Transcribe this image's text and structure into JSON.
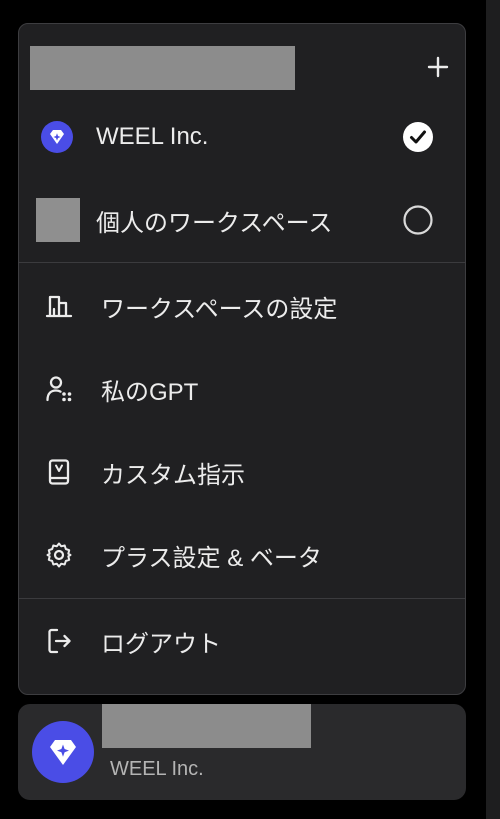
{
  "menu": {
    "add_workspace_icon": "plus-icon",
    "workspaces": [
      {
        "label": "WEEL Inc.",
        "icon": "diamond-sparkle-logo-icon",
        "selected": true,
        "accent": "#4a4de6"
      },
      {
        "label": "個人のワークスペース",
        "icon": "avatar-placeholder",
        "selected": false
      }
    ],
    "items": [
      {
        "label": "ワークスペースの設定",
        "icon": "building-icon"
      },
      {
        "label": "私のGPT",
        "icon": "user-dots-icon"
      },
      {
        "label": "カスタム指示",
        "icon": "book-icon"
      },
      {
        "label": "プラス設定 & ベータ",
        "icon": "gear-icon"
      }
    ],
    "logout": {
      "label": "ログアウト",
      "icon": "logout-icon"
    }
  },
  "account": {
    "org_name": "WEEL Inc.",
    "avatar_icon": "diamond-sparkle-logo-icon",
    "avatar_color": "#4a4de6"
  }
}
